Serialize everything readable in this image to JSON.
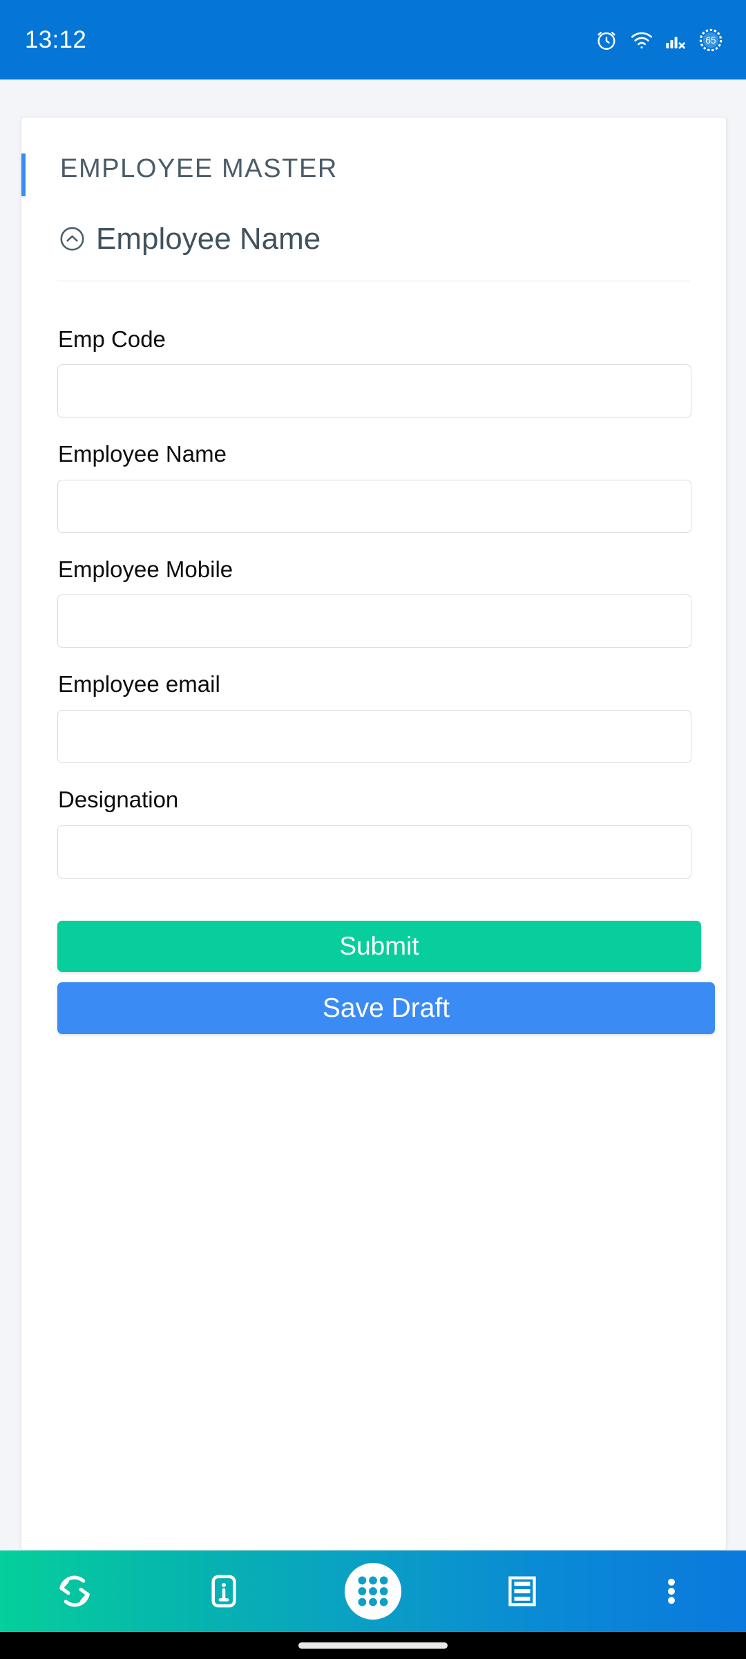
{
  "statusbar": {
    "clock": "13:12",
    "battery_percent": "65",
    "icons": [
      "alarm-clock-icon",
      "wifi-icon",
      "cellular-no-sim-icon",
      "battery-icon"
    ],
    "background_color": "#0576d6"
  },
  "card": {
    "title": "EMPLOYEE MASTER",
    "accent_color": "#3b8bf4",
    "section": {
      "title": "Employee Name",
      "collapse_icon": "chevron-up-circle-icon",
      "expanded": true
    }
  },
  "form": {
    "fields": [
      {
        "label": "Emp Code",
        "value": "",
        "placeholder": "",
        "name": "emp-code"
      },
      {
        "label": "Employee Name",
        "value": "",
        "placeholder": "",
        "name": "employee-name"
      },
      {
        "label": "Employee Mobile",
        "value": "",
        "placeholder": "",
        "name": "employee-mobile"
      },
      {
        "label": "Employee email",
        "value": "",
        "placeholder": "",
        "name": "employee-email"
      },
      {
        "label": "Designation",
        "value": "",
        "placeholder": "",
        "name": "designation"
      }
    ],
    "submit_label": "Submit",
    "submit_color": "#07ce9c",
    "draft_label": "Save Draft",
    "draft_color": "#3b8bf4"
  },
  "bottomnav": {
    "gradient_from": "#05cf9b",
    "gradient_to": "#0a79dd",
    "items": [
      {
        "icon": "sync-refresh-icon",
        "name": "nav-sync"
      },
      {
        "icon": "info-icon",
        "name": "nav-info"
      },
      {
        "icon": "apps-grid-icon",
        "name": "nav-apps"
      },
      {
        "icon": "list-lines-icon",
        "name": "nav-list"
      },
      {
        "icon": "more-vertical-icon",
        "name": "nav-more"
      }
    ]
  }
}
